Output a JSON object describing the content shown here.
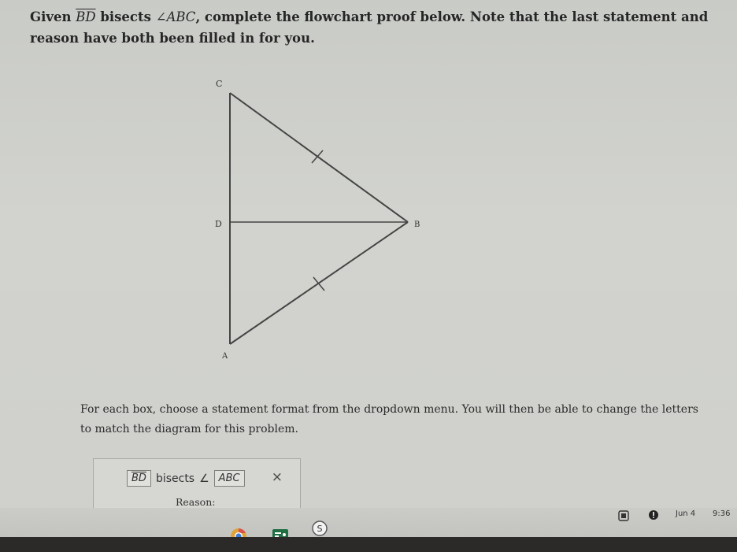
{
  "prompt": {
    "given": "Given",
    "seg": "BD",
    "bisects": "bisects",
    "angle": "∠ABC",
    "rest": ", complete the flowchart proof below. Note that the last statement and reason have both been filled in for you."
  },
  "diagram": {
    "labels": {
      "c": "C",
      "d": "D",
      "b": "B",
      "a": "A"
    }
  },
  "instructions": "For each box, choose a statement format from the dropdown menu. You will then be able to change the letters to match the diagram for this problem.",
  "proof_box": {
    "segment": "BD",
    "verb": "bisects",
    "angle_symbol": "∠",
    "angle": "ABC",
    "close": "×",
    "reason_label": "Reason:"
  },
  "taskbar": {
    "date": "Jun 4",
    "time": "9:36",
    "icons": [
      "chrome-icon",
      "classroom-icon",
      "s-app-icon",
      "screenshot-icon",
      "notification-icon"
    ]
  }
}
